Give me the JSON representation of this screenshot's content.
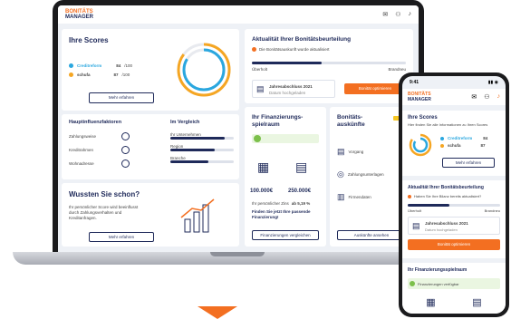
{
  "brand": {
    "top": "BONITÄTS",
    "bottom": "MANAGER"
  },
  "scores": {
    "title": "Ihre Scores",
    "items": [
      {
        "name": "Creditreform",
        "value": "84",
        "unit": "/100"
      },
      {
        "name": "schufa",
        "value": "87",
        "unit": "/100"
      }
    ],
    "more_button": "Mehr erfahren"
  },
  "factors": {
    "title": "Hauptinfluenzfaktoren",
    "items": [
      "Zahlungsweise",
      "Kreditrahmen",
      "Wohnadresse"
    ],
    "compare_title": "Im Vergleich",
    "compare_items": [
      {
        "label": "Ihr Unternehmen",
        "fill": 0.85
      },
      {
        "label": "Region",
        "fill": 0.7
      },
      {
        "label": "Branche",
        "fill": 0.6
      }
    ]
  },
  "wissen": {
    "title": "Wussten Sie schon?",
    "text": "Ihr persönlicher Score wird beeinflusst durch Zahlungsverhalten und Kreditanfragen.",
    "button": "Mehr erfahren"
  },
  "aktualitaet": {
    "title": "Aktualität Ihrer Bonitätsbeurteilung",
    "notice": "Die Bonitätsauskunft wurde aktualisiert",
    "left_label": "Überholt",
    "right_label": "Brandneu",
    "doc_title": "Jahresabschluss 2021",
    "doc_sub": "Datum hochgeladen",
    "button": "Bonität optimieren"
  },
  "finanzierung": {
    "title": "Ihr Finanzierungs-spielraum",
    "amount1": "100.000€",
    "amount2": "250.000€",
    "rate_text": "Ihr persönlicher Zins",
    "rate_value": "ab 5,19 %",
    "offer": "Finden Sie jetzt Ihre passende Finanzierung!",
    "button": "Finanzierungen vergleichen"
  },
  "auskuenfte": {
    "title": "Bonitäts-auskünfte",
    "items": [
      "Vorgang",
      "Zahlungsunterlagen",
      "Firmendaten"
    ],
    "button": "Auskünfte ansehen"
  },
  "phone": {
    "time": "9:41",
    "scores_title": "Ihre Scores",
    "scores_sub": "Hier finden Sie alle Informationen zu Ihren Scores",
    "items": [
      {
        "name": "Creditreform",
        "value": "84"
      },
      {
        "name": "schufa",
        "value": "87"
      }
    ],
    "more_button": "Mehr erfahren",
    "akt_title": "Aktualität Ihrer Bonitätsbeurteilung",
    "akt_notice": "Haben Sie Ihre Bilanz bereits aktualisiert?",
    "left_label": "Überholt",
    "right_label": "Brandneu",
    "doc_title": "Jahresabschluss 2021",
    "doc_sub": "Datum hochgeladen",
    "button": "Bonität optimieren",
    "fin_title": "Ihr Finanzierungsspielraum",
    "fin_notice": "Finanzierungen verfügbar"
  }
}
